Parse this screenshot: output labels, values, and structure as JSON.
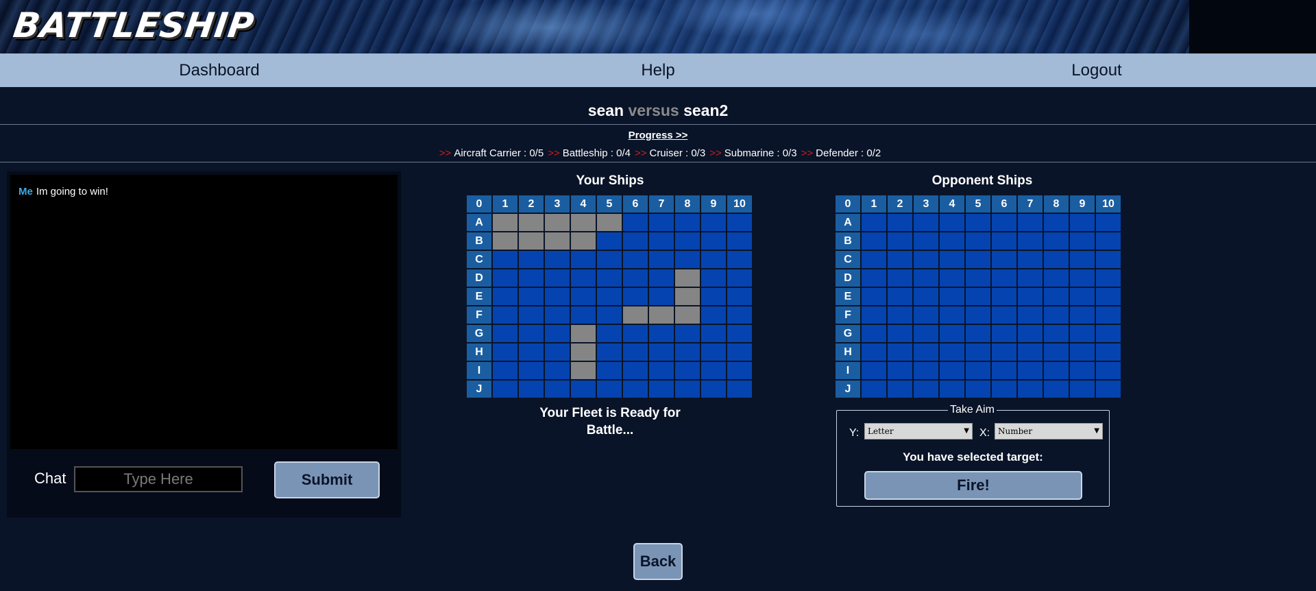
{
  "app": {
    "logo": "BATTLESHIP"
  },
  "nav": {
    "dashboard": "Dashboard",
    "help": "Help",
    "logout": "Logout"
  },
  "match": {
    "player": "sean",
    "versus": "versus",
    "opponent": "sean2"
  },
  "progress": {
    "link_label": "Progress >>",
    "arrow": ">>",
    "ships": [
      {
        "label": "Aircraft Carrier : 0/5"
      },
      {
        "label": "Battleship : 0/4"
      },
      {
        "label": "Cruiser : 0/3"
      },
      {
        "label": "Submarine : 0/3"
      },
      {
        "label": "Defender : 0/2"
      }
    ]
  },
  "chat": {
    "messages": [
      {
        "user": "Me",
        "text": "Im going to win!"
      }
    ],
    "label": "Chat",
    "placeholder": "Type Here",
    "submit_label": "Submit"
  },
  "boards": {
    "corner": "0",
    "columns": [
      "1",
      "2",
      "3",
      "4",
      "5",
      "6",
      "7",
      "8",
      "9",
      "10"
    ],
    "rows": [
      "A",
      "B",
      "C",
      "D",
      "E",
      "F",
      "G",
      "H",
      "I",
      "J"
    ],
    "your_ships": {
      "title": "Your Ships",
      "ship_cells": [
        "A1",
        "A2",
        "A3",
        "A4",
        "A5",
        "B1",
        "B2",
        "B3",
        "B4",
        "D8",
        "E8",
        "F6",
        "F7",
        "F8",
        "G4",
        "H4",
        "I4"
      ]
    },
    "opponent_ships": {
      "title": "Opponent Ships",
      "ship_cells": []
    },
    "fleet_message": "Your Fleet is Ready for Battle..."
  },
  "aim": {
    "legend": "Take Aim",
    "y_label": "Y:",
    "x_label": "X:",
    "y_selected": "Letter",
    "x_selected": "Number",
    "target_text": "You have selected target:",
    "fire_label": "Fire!"
  },
  "back_label": "Back",
  "colors": {
    "water": "#0544b0",
    "ship": "#858585",
    "header_cell": "#1a5ea1",
    "nav_bg": "#a3bbd6",
    "button": "#7a94b6",
    "progress_arrow": "#d11b1b",
    "chat_user": "#3fa9e6"
  }
}
